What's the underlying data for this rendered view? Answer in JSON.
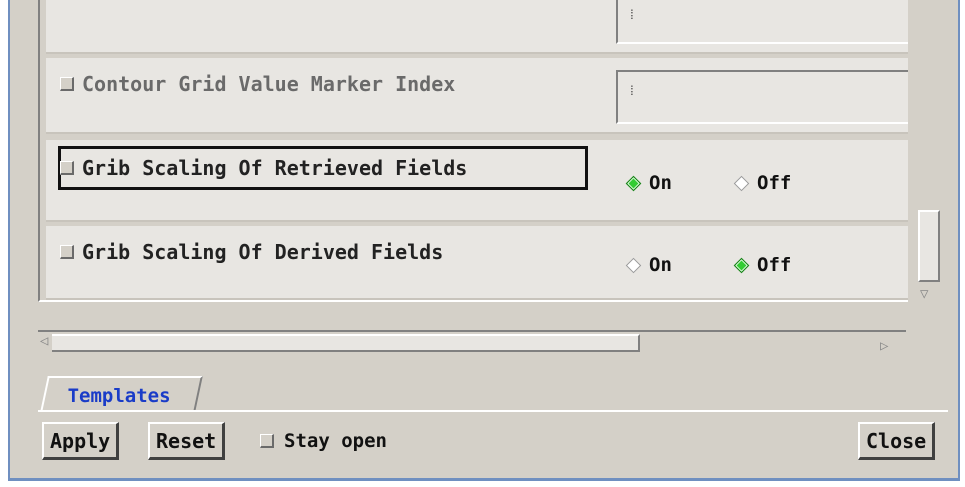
{
  "rows": {
    "marker_index": {
      "label": "Contour Grid Value Marker Index",
      "value": ""
    },
    "retrieved": {
      "label": "Grib Scaling Of Retrieved Fields",
      "on_label": "On",
      "off_label": "Off",
      "selected": "On"
    },
    "derived": {
      "label": "Grib Scaling Of Derived Fields",
      "on_label": "On",
      "off_label": "Off",
      "selected": "Off"
    }
  },
  "tabs": [
    {
      "label": "Templates"
    }
  ],
  "footer": {
    "apply_label": "Apply",
    "reset_label": "Reset",
    "stay_open_label": "Stay open",
    "close_label": "Close"
  },
  "colors": {
    "selected_radio": "#33cc33",
    "tab_text": "#1a3cc8"
  },
  "icons": [
    "checkbox-icon",
    "radio-on-icon",
    "radio-off-icon",
    "scroll-arrow-icon"
  ]
}
